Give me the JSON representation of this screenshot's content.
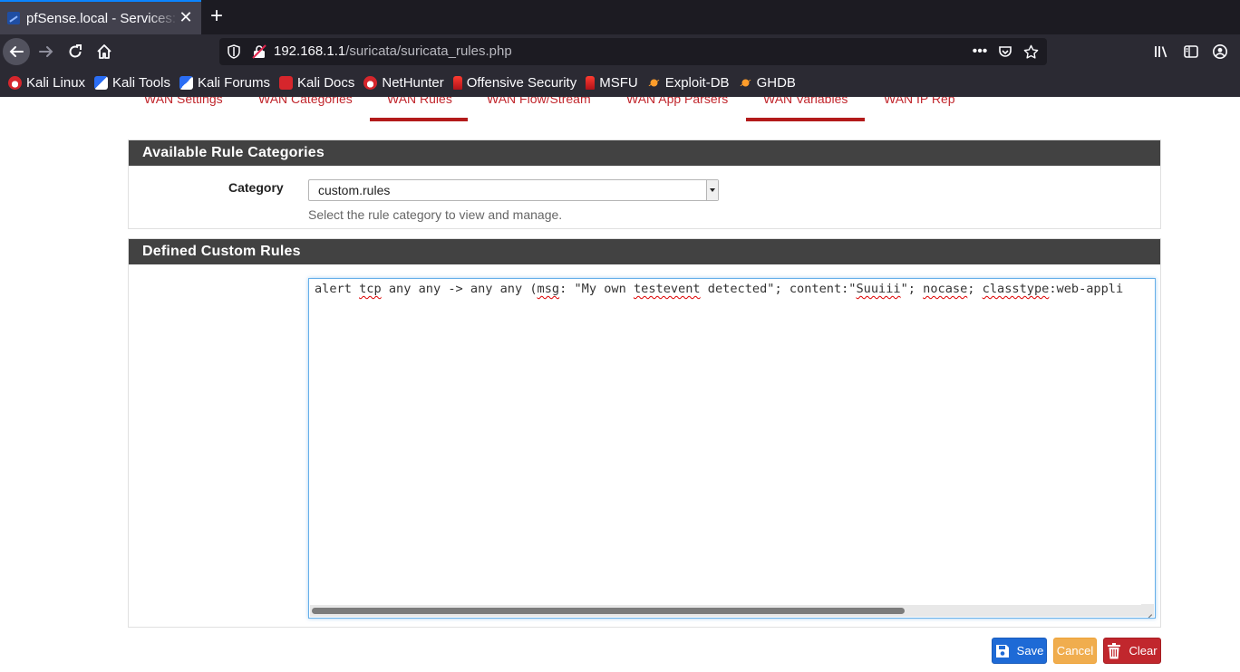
{
  "browser": {
    "tab_title": "pfSense.local - Services: S",
    "new_tab": "+",
    "close_tab": "✕",
    "url_host": "192.168.1.1",
    "url_path": "/suricata/suricata_rules.php",
    "url_more": "•••"
  },
  "bookmarks": [
    {
      "label": "Kali Linux",
      "icon": "kali-dragon-icon"
    },
    {
      "label": "Kali Tools",
      "icon": "kali-tools-icon"
    },
    {
      "label": "Kali Forums",
      "icon": "kali-forums-icon"
    },
    {
      "label": "Kali Docs",
      "icon": "kali-docs-icon"
    },
    {
      "label": "NetHunter",
      "icon": "nethunter-icon"
    },
    {
      "label": "Offensive Security",
      "icon": "offsec-icon"
    },
    {
      "label": "MSFU",
      "icon": "msfu-icon"
    },
    {
      "label": "Exploit-DB",
      "icon": "exploit-db-icon"
    },
    {
      "label": "GHDB",
      "icon": "ghdb-icon"
    }
  ],
  "subtabs": [
    {
      "label": "WAN Settings"
    },
    {
      "label": "WAN Categories"
    },
    {
      "label": "WAN Rules"
    },
    {
      "label": "WAN Flow/Stream"
    },
    {
      "label": "WAN App Parsers"
    },
    {
      "label": "WAN Variables"
    },
    {
      "label": "WAN IP Rep"
    }
  ],
  "categories_panel": {
    "title": "Available Rule Categories",
    "category_label": "Category",
    "category_value": "custom.rules",
    "help_text": "Select the rule category to view and manage."
  },
  "rules_panel": {
    "title": "Defined Custom Rules",
    "code": {
      "t1": "alert ",
      "t2": "tcp",
      "t3": " any any -> any any (",
      "t4": "msg",
      "t5": ": \"My own ",
      "t6": "testevent",
      "t7": " detected\"; content:\"",
      "t8": "Suuiii",
      "t9": "\"; ",
      "t10": "nocase",
      "t11": "; ",
      "t12": "classtype",
      "t13": ":web-appli"
    }
  },
  "buttons": {
    "save": "Save",
    "cancel": "Cancel",
    "clear": "Clear"
  },
  "colors": {
    "accent_red": "#c1272d",
    "save_blue": "#1e6ad6",
    "cancel_orange": "#f0ad4e",
    "panel_header": "#424242"
  }
}
